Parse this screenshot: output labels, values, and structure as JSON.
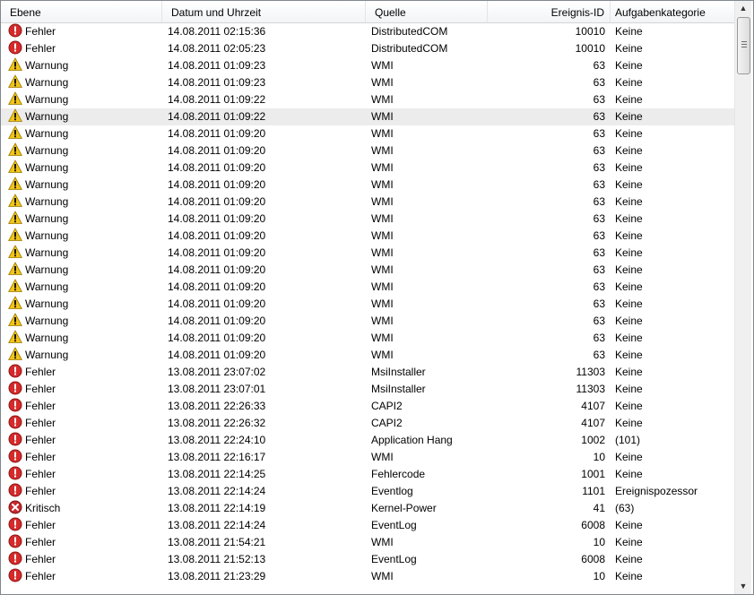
{
  "columns": {
    "level": "Ebene",
    "date": "Datum und Uhrzeit",
    "source": "Quelle",
    "id": "Ereignis-ID",
    "category": "Aufgabenkategorie"
  },
  "colors": {
    "error": "#d62a2a",
    "warning": "#f0c419",
    "critical": "#c9282d",
    "selected_row": "#ececec"
  },
  "rows": [
    {
      "icon": "error-icon",
      "level": "Fehler",
      "date": "14.08.2011 02:15:36",
      "source": "DistributedCOM",
      "id": "10010",
      "category": "Keine"
    },
    {
      "icon": "error-icon",
      "level": "Fehler",
      "date": "14.08.2011 02:05:23",
      "source": "DistributedCOM",
      "id": "10010",
      "category": "Keine"
    },
    {
      "icon": "warning-icon",
      "level": "Warnung",
      "date": "14.08.2011 01:09:23",
      "source": "WMI",
      "id": "63",
      "category": "Keine"
    },
    {
      "icon": "warning-icon",
      "level": "Warnung",
      "date": "14.08.2011 01:09:23",
      "source": "WMI",
      "id": "63",
      "category": "Keine"
    },
    {
      "icon": "warning-icon",
      "level": "Warnung",
      "date": "14.08.2011 01:09:22",
      "source": "WMI",
      "id": "63",
      "category": "Keine"
    },
    {
      "icon": "warning-icon",
      "level": "Warnung",
      "date": "14.08.2011 01:09:22",
      "source": "WMI",
      "id": "63",
      "category": "Keine",
      "selected": true
    },
    {
      "icon": "warning-icon",
      "level": "Warnung",
      "date": "14.08.2011 01:09:20",
      "source": "WMI",
      "id": "63",
      "category": "Keine"
    },
    {
      "icon": "warning-icon",
      "level": "Warnung",
      "date": "14.08.2011 01:09:20",
      "source": "WMI",
      "id": "63",
      "category": "Keine"
    },
    {
      "icon": "warning-icon",
      "level": "Warnung",
      "date": "14.08.2011 01:09:20",
      "source": "WMI",
      "id": "63",
      "category": "Keine"
    },
    {
      "icon": "warning-icon",
      "level": "Warnung",
      "date": "14.08.2011 01:09:20",
      "source": "WMI",
      "id": "63",
      "category": "Keine"
    },
    {
      "icon": "warning-icon",
      "level": "Warnung",
      "date": "14.08.2011 01:09:20",
      "source": "WMI",
      "id": "63",
      "category": "Keine"
    },
    {
      "icon": "warning-icon",
      "level": "Warnung",
      "date": "14.08.2011 01:09:20",
      "source": "WMI",
      "id": "63",
      "category": "Keine"
    },
    {
      "icon": "warning-icon",
      "level": "Warnung",
      "date": "14.08.2011 01:09:20",
      "source": "WMI",
      "id": "63",
      "category": "Keine"
    },
    {
      "icon": "warning-icon",
      "level": "Warnung",
      "date": "14.08.2011 01:09:20",
      "source": "WMI",
      "id": "63",
      "category": "Keine"
    },
    {
      "icon": "warning-icon",
      "level": "Warnung",
      "date": "14.08.2011 01:09:20",
      "source": "WMI",
      "id": "63",
      "category": "Keine"
    },
    {
      "icon": "warning-icon",
      "level": "Warnung",
      "date": "14.08.2011 01:09:20",
      "source": "WMI",
      "id": "63",
      "category": "Keine"
    },
    {
      "icon": "warning-icon",
      "level": "Warnung",
      "date": "14.08.2011 01:09:20",
      "source": "WMI",
      "id": "63",
      "category": "Keine"
    },
    {
      "icon": "warning-icon",
      "level": "Warnung",
      "date": "14.08.2011 01:09:20",
      "source": "WMI",
      "id": "63",
      "category": "Keine"
    },
    {
      "icon": "warning-icon",
      "level": "Warnung",
      "date": "14.08.2011 01:09:20",
      "source": "WMI",
      "id": "63",
      "category": "Keine"
    },
    {
      "icon": "warning-icon",
      "level": "Warnung",
      "date": "14.08.2011 01:09:20",
      "source": "WMI",
      "id": "63",
      "category": "Keine"
    },
    {
      "icon": "error-icon",
      "level": "Fehler",
      "date": "13.08.2011 23:07:02",
      "source": "MsiInstaller",
      "id": "11303",
      "category": "Keine"
    },
    {
      "icon": "error-icon",
      "level": "Fehler",
      "date": "13.08.2011 23:07:01",
      "source": "MsiInstaller",
      "id": "11303",
      "category": "Keine"
    },
    {
      "icon": "error-icon",
      "level": "Fehler",
      "date": "13.08.2011 22:26:33",
      "source": "CAPI2",
      "id": "4107",
      "category": "Keine"
    },
    {
      "icon": "error-icon",
      "level": "Fehler",
      "date": "13.08.2011 22:26:32",
      "source": "CAPI2",
      "id": "4107",
      "category": "Keine"
    },
    {
      "icon": "error-icon",
      "level": "Fehler",
      "date": "13.08.2011 22:24:10",
      "source": "Application Hang",
      "id": "1002",
      "category": "(101)"
    },
    {
      "icon": "error-icon",
      "level": "Fehler",
      "date": "13.08.2011 22:16:17",
      "source": "WMI",
      "id": "10",
      "category": "Keine"
    },
    {
      "icon": "error-icon",
      "level": "Fehler",
      "date": "13.08.2011 22:14:25",
      "source": "Fehlercode",
      "id": "1001",
      "category": "Keine"
    },
    {
      "icon": "error-icon",
      "level": "Fehler",
      "date": "13.08.2011 22:14:24",
      "source": "Eventlog",
      "id": "1101",
      "category": "Ereignispozessor"
    },
    {
      "icon": "critical-icon",
      "level": "Kritisch",
      "date": "13.08.2011 22:14:19",
      "source": "Kernel-Power",
      "id": "41",
      "category": "(63)"
    },
    {
      "icon": "error-icon",
      "level": "Fehler",
      "date": "13.08.2011 22:14:24",
      "source": "EventLog",
      "id": "6008",
      "category": "Keine"
    },
    {
      "icon": "error-icon",
      "level": "Fehler",
      "date": "13.08.2011 21:54:21",
      "source": "WMI",
      "id": "10",
      "category": "Keine"
    },
    {
      "icon": "error-icon",
      "level": "Fehler",
      "date": "13.08.2011 21:52:13",
      "source": "EventLog",
      "id": "6008",
      "category": "Keine"
    },
    {
      "icon": "error-icon",
      "level": "Fehler",
      "date": "13.08.2011 21:23:29",
      "source": "WMI",
      "id": "10",
      "category": "Keine"
    }
  ],
  "scrollbar": {
    "up_icon": "scroll-up-icon",
    "down_icon": "scroll-down-icon"
  }
}
